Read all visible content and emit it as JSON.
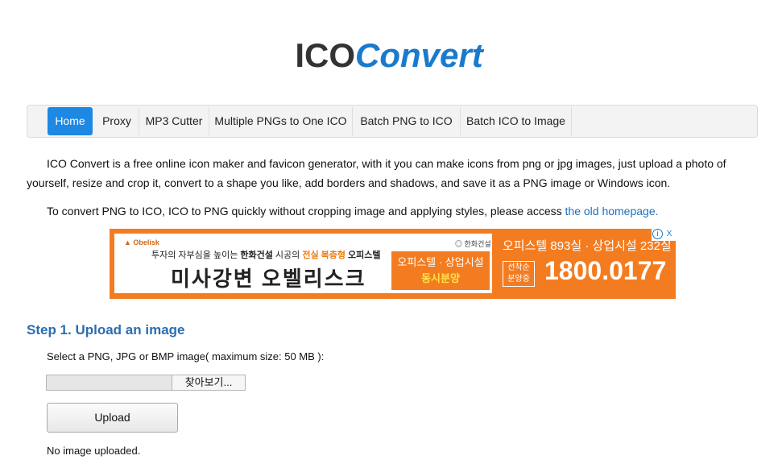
{
  "logo": {
    "part1": "ICO",
    "part2": "Convert"
  },
  "nav": {
    "items": [
      {
        "label": "Home",
        "active": true
      },
      {
        "label": "Proxy"
      },
      {
        "label": "MP3 Cutter"
      },
      {
        "label": "Multiple PNGs to One ICO"
      },
      {
        "label": "Batch PNG to ICO"
      },
      {
        "label": "Batch ICO to Image"
      }
    ]
  },
  "intro": {
    "text": "ICO Convert is a free online icon maker and favicon generator, with it you can make icons from png or jpg images, just upload a photo of yourself, resize and crop it, convert to a shape you like, add borders and shadows, and save it as a PNG image or Windows icon.",
    "old_text": "To convert PNG to ICO, ICO to PNG quickly without cropping image and applying styles, please access ",
    "old_link": "the old homepage."
  },
  "ad": {
    "brand_left": "Obelisk",
    "brand_right": "한화건설",
    "subline_a": "투자의 자부심을 높이는 ",
    "subline_b": "한화건설",
    "subline_c": " 시공의 ",
    "subline_d": "전실 복층형",
    "subline_e": " 오피스텔",
    "headline": "미사강변 오벨리스크",
    "box_line1": "오피스텔 · 상업시설",
    "box_line2": "동시분양",
    "right_line": "오피스텔 893실 · 상업시설 232실",
    "badge": "선착순 분양중",
    "phone": "1800.0177",
    "info_glyph": "i",
    "close_glyph": "X"
  },
  "step1": {
    "title": "Step 1. Upload an image",
    "select_label": "Select a PNG, JPG or BMP image( maximum size: 50 MB ):",
    "browse_label": "찾아보기...",
    "upload_label": "Upload",
    "status": "No image uploaded."
  },
  "colors": {
    "accent": "#1e88e5",
    "logo_blue": "#1a7acc",
    "step_blue": "#2a6db0",
    "ad_orange": "#f47c20"
  }
}
